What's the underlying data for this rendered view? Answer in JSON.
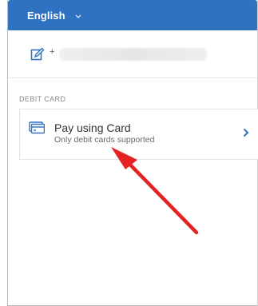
{
  "header": {
    "language_label": "English",
    "accent_color": "#2f72c1"
  },
  "contact": {
    "phone_prefix": "+",
    "icon": "edit-icon"
  },
  "section": {
    "label": "DEBIT CARD"
  },
  "payment_option": {
    "title": "Pay using Card",
    "subtitle": "Only debit cards supported",
    "icon": "card-icon",
    "chevron": "chevron-right-icon"
  },
  "annotation": {
    "type": "arrow",
    "color": "#e52222",
    "points_to": "payment_option"
  }
}
